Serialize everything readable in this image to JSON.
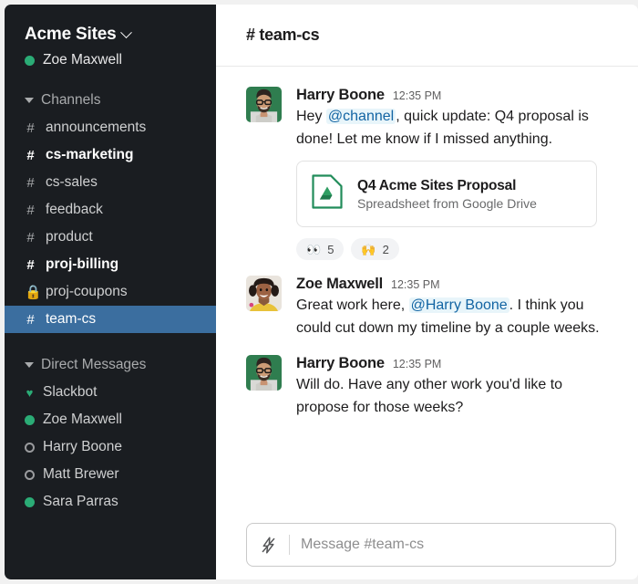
{
  "sidebar": {
    "workspace_name": "Acme Sites",
    "workspace_chevron_icon": "chevron-down-icon",
    "current_user": "Zoe Maxwell",
    "current_user_presence": "active",
    "channels_section": {
      "label": "Channels",
      "collapse_icon": "triangle-down-icon",
      "items": [
        {
          "name": "announcements",
          "glyph": "#",
          "unread": false,
          "selected": false,
          "private": false
        },
        {
          "name": "cs-marketing",
          "glyph": "#",
          "unread": true,
          "selected": false,
          "private": false
        },
        {
          "name": "cs-sales",
          "glyph": "#",
          "unread": false,
          "selected": false,
          "private": false
        },
        {
          "name": "feedback",
          "glyph": "#",
          "unread": false,
          "selected": false,
          "private": false
        },
        {
          "name": "product",
          "glyph": "#",
          "unread": false,
          "selected": false,
          "private": false
        },
        {
          "name": "proj-billing",
          "glyph": "#",
          "unread": true,
          "selected": false,
          "private": false
        },
        {
          "name": "proj-coupons",
          "glyph": "🔒",
          "unread": false,
          "selected": false,
          "private": true
        },
        {
          "name": "team-cs",
          "glyph": "#",
          "unread": false,
          "selected": true,
          "private": false
        }
      ]
    },
    "dms_section": {
      "label": "Direct Messages",
      "collapse_icon": "triangle-down-icon",
      "items": [
        {
          "name": "Slackbot",
          "presence": "heart"
        },
        {
          "name": "Zoe Maxwell",
          "presence": "active"
        },
        {
          "name": "Harry Boone",
          "presence": "away"
        },
        {
          "name": "Matt Brewer",
          "presence": "away"
        },
        {
          "name": "Sara Parras",
          "presence": "active"
        }
      ]
    }
  },
  "channel": {
    "header_title": "# team-cs"
  },
  "messages": [
    {
      "author": "Harry Boone",
      "time": "12:35 PM",
      "avatar": "harry",
      "text_before": "Hey ",
      "mention": "@channel",
      "text_after": ", quick update: Q4 proposal is done! Let me know if I missed anything.",
      "attachment": {
        "icon": "google-drive-file-icon",
        "title": "Q4 Acme Sites Proposal",
        "subtitle": "Spreadsheet from Google Drive"
      },
      "reactions": [
        {
          "emoji": "👀",
          "name": "eyes",
          "count": "5"
        },
        {
          "emoji": "🙌",
          "name": "raised-hands",
          "count": "2"
        }
      ]
    },
    {
      "author": "Zoe Maxwell",
      "time": "12:35 PM",
      "avatar": "zoe",
      "text_before": "Great work here, ",
      "mention": "@Harry Boone",
      "text_after": ". I think you could cut down my timeline by a couple weeks."
    },
    {
      "author": "Harry Boone",
      "time": "12:35 PM",
      "avatar": "harry",
      "text_before": "Will do. Have any other work you'd like to propose for those weeks?",
      "mention": "",
      "text_after": ""
    }
  ],
  "composer": {
    "lightning_icon": "lightning-bolt-icon",
    "placeholder": "Message #team-cs",
    "value": ""
  },
  "colors": {
    "sidebar_bg": "#1a1d21",
    "selected_channel": "#3b6e9f",
    "presence_active": "#2bac76",
    "mention_text": "#1264a3",
    "mention_bg": "#e8f5fa",
    "drive_green": "#218c5a",
    "page_bg": "#f1f1f1"
  }
}
